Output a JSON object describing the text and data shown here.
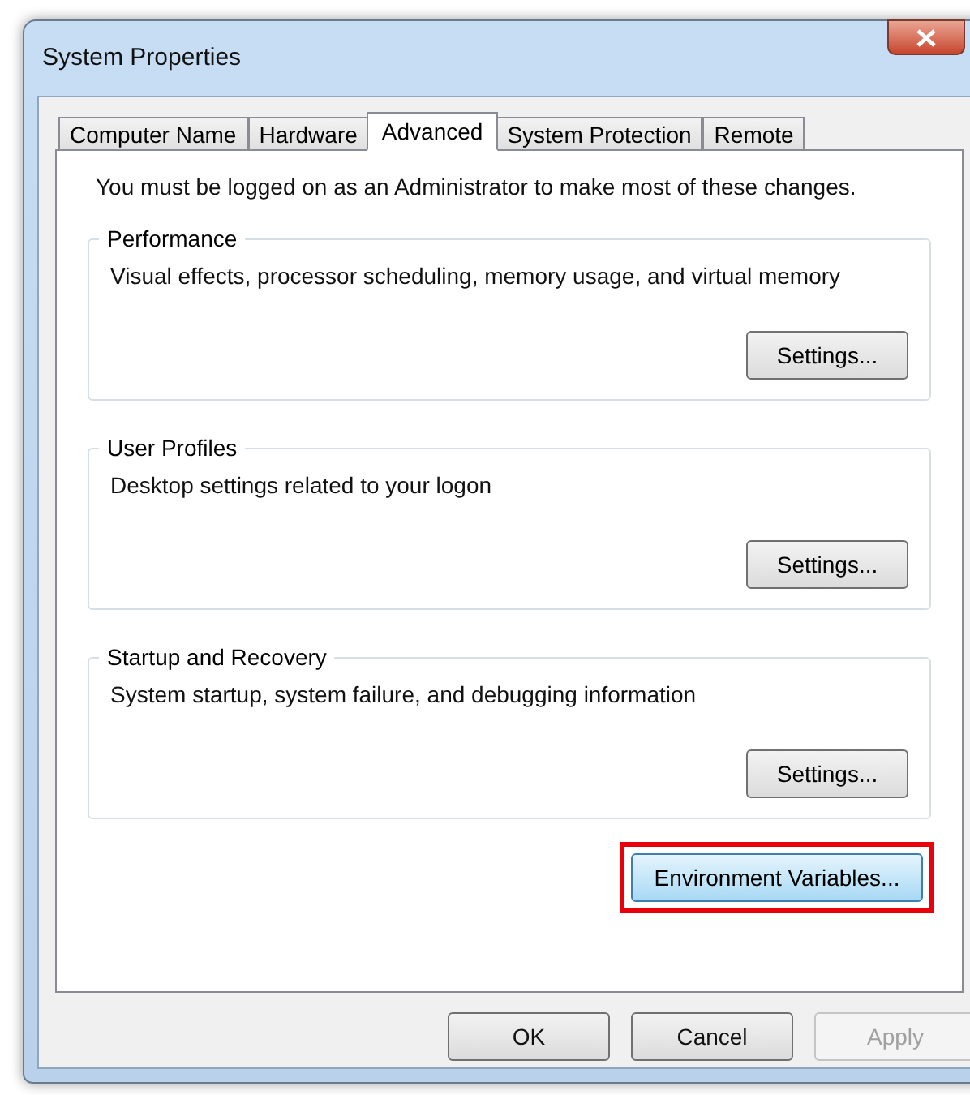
{
  "window": {
    "title": "System Properties"
  },
  "tabs": [
    {
      "label": "Computer Name",
      "selected": false
    },
    {
      "label": "Hardware",
      "selected": false
    },
    {
      "label": "Advanced",
      "selected": true
    },
    {
      "label": "System Protection",
      "selected": false
    },
    {
      "label": "Remote",
      "selected": false
    }
  ],
  "notice": "You must be logged on as an Administrator to make most of these changes.",
  "groups": [
    {
      "title": "Performance",
      "description": "Visual effects, processor scheduling, memory usage, and virtual memory",
      "button": "Settings..."
    },
    {
      "title": "User Profiles",
      "description": "Desktop settings related to your logon",
      "button": "Settings..."
    },
    {
      "title": "Startup and Recovery",
      "description": "System startup, system failure, and debugging information",
      "button": "Settings..."
    }
  ],
  "environment_button": {
    "label": "Environment Variables...",
    "highlighted": true
  },
  "buttons": [
    {
      "label": "OK",
      "disabled": false
    },
    {
      "label": "Cancel",
      "disabled": false
    },
    {
      "label": "Apply",
      "disabled": true
    }
  ]
}
